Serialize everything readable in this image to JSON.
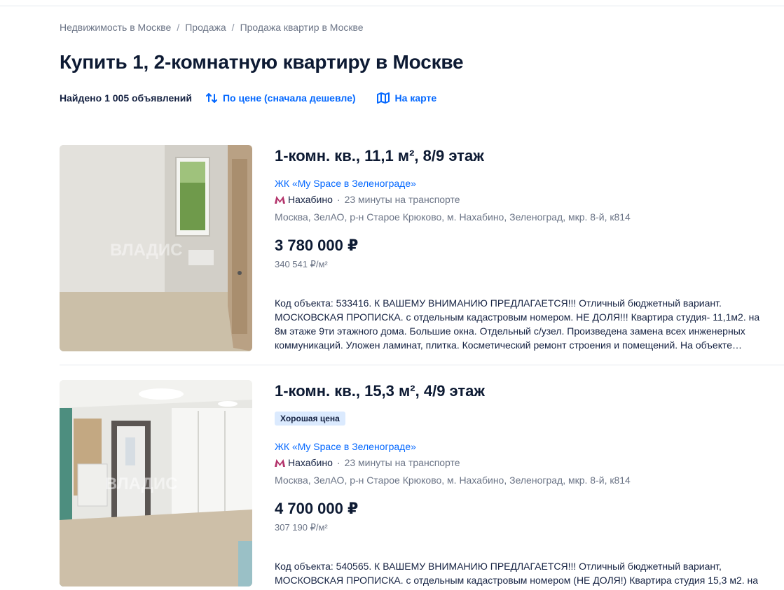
{
  "breadcrumbs": [
    "Недвижимость в Москве",
    "Продажа",
    "Продажа квартир в Москве"
  ],
  "page_title": "Купить 1, 2-комнатную квартиру в Москве",
  "toolbar": {
    "found": "Найдено 1 005 объявлений",
    "sort_label": "По цене (сначала дешевле)",
    "map_label": "На карте"
  },
  "listings": [
    {
      "title": "1-комн. кв., 11,1 м², 8/9 этаж",
      "badge": "",
      "complex": "ЖК «My Space в Зеленограде»",
      "metro": "Нахабино",
      "metro_time": "23 минуты на транспорте",
      "address": "Москва, ЗелАО, р-н Старое Крюково, м. Нахабино, Зеленоград, мкр. 8-й, к814",
      "price": "3 780 000 ₽",
      "price_per_m": "340 541 ₽/м²",
      "description": "Код объекта: 533416. К ВАШЕМУ ВНИМАНИЮ ПРЕДЛАГАЕТСЯ!!! Отличный бюджетный вариант. МОСКОВСКАЯ ПРОПИСКА. с отдельным кадастровым номером. НЕ ДОЛЯ!!! Квартира студия- 11,1м2. на 8м этаже 9ти этажного дома. Большие окна. Отдельный с/узел. Произведена замена всех инженерных коммуникаций. Уложен ламинат, плитка. Косметический ремонт строения и помещений. На объекте…",
      "photo_watermark": "ВЛАДИС"
    },
    {
      "title": "1-комн. кв., 15,3 м², 4/9 этаж",
      "badge": "Хорошая цена",
      "complex": "ЖК «My Space в Зеленограде»",
      "metro": "Нахабино",
      "metro_time": "23 минуты на транспорте",
      "address": "Москва, ЗелАО, р-н Старое Крюково, м. Нахабино, Зеленоград, мкр. 8-й, к814",
      "price": "4 700 000 ₽",
      "price_per_m": "307 190 ₽/м²",
      "description": "Код объекта: 540565. К ВАШЕМУ ВНИМАНИЮ ПРЕДЛАГАЕТСЯ!!! Отличный бюджетный вариант, МОСКОВСКАЯ ПРОПИСКА. с отдельным кадастровым номером (НЕ ДОЛЯ!) Квартира студия 15,3 м2. на",
      "photo_watermark": "ВЛАДИС"
    }
  ],
  "colors": {
    "link": "#0468ff",
    "text": "#152242",
    "muted": "#6b7486",
    "metro": "#b3336b",
    "badge_bg": "#dbeafe"
  }
}
